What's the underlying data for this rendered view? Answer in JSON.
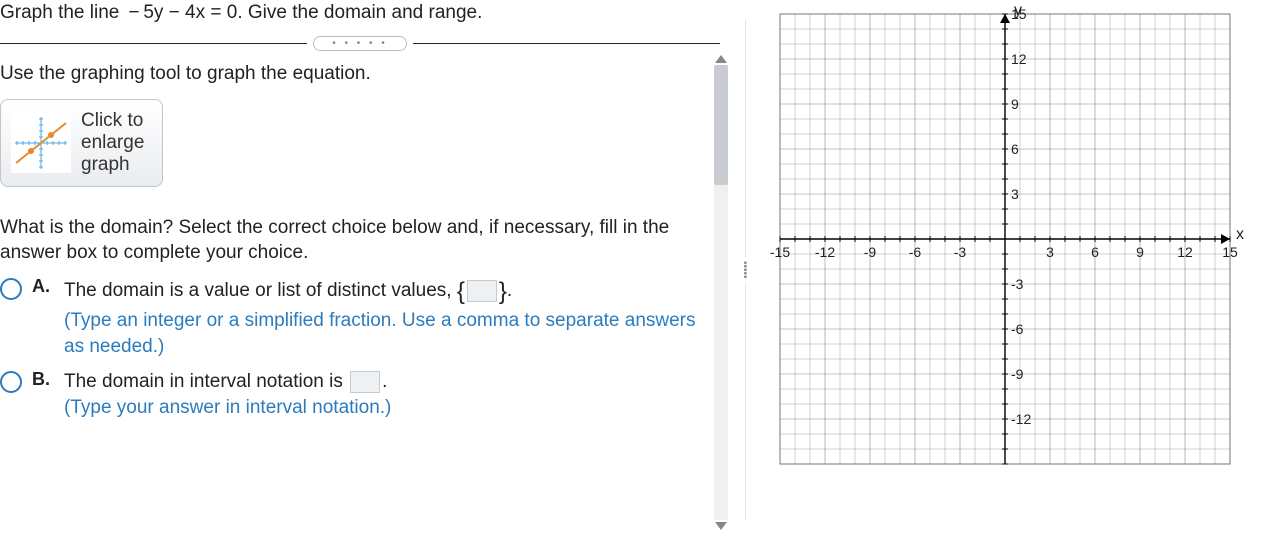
{
  "question": "Graph the line  − 5y − 4x = 0. Give the domain and range.",
  "collapse_dots": "• • • • •",
  "instruction": "Use the graphing tool to graph the equation.",
  "enlarge_button": {
    "line1": "Click to",
    "line2": "enlarge",
    "line3": "graph"
  },
  "domain_question": "What is the domain? Select the correct choice below and, if necessary, fill in the answer box to complete your choice.",
  "choice_a": {
    "label": "A.",
    "text_before": "The domain is a value or list of distinct values, ",
    "text_after": ".",
    "hint": "(Type an integer or a simplified fraction. Use a comma to separate answers as needed.)"
  },
  "choice_b": {
    "label": "B.",
    "text_before": "The domain in interval notation is ",
    "text_after": ".",
    "hint": "(Type your answer in interval notation.)"
  },
  "chart_data": {
    "type": "line",
    "title": "",
    "xlabel": "x",
    "ylabel": "y",
    "xlim": [
      -15,
      15
    ],
    "ylim": [
      -15,
      15
    ],
    "x_ticks": [
      -15,
      -12,
      -9,
      -6,
      -3,
      3,
      6,
      9,
      12,
      15
    ],
    "y_ticks": [
      -12,
      -9,
      -6,
      -3,
      3,
      6,
      9,
      12,
      15
    ],
    "grid": true,
    "series": []
  },
  "divider_dots": "•••••"
}
